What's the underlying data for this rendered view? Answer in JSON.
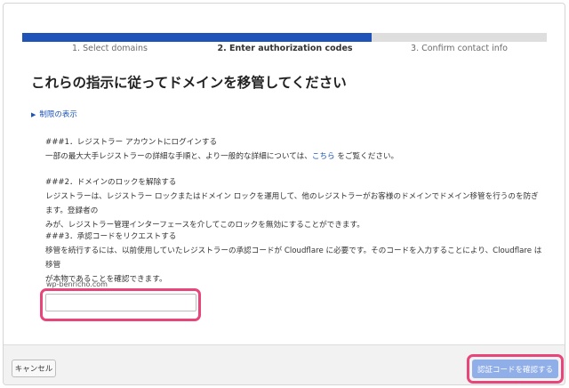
{
  "steps": [
    {
      "label": "1. Select domains",
      "status": "complete"
    },
    {
      "label": "2. Enter authorization codes",
      "status": "current"
    },
    {
      "label": "3. Confirm contact info",
      "status": "pending"
    }
  ],
  "page": {
    "title": "これらの指示に従ってドメインを移管してください",
    "toggle_label": "制限の表示"
  },
  "sections": [
    {
      "heading": "###1．レジストラー アカウントにログインする",
      "body_pre": "一部の最大大手レジストラーの詳細な手順と、より一般的な詳細については、",
      "link": "こちら",
      "body_post": " をご覧ください。"
    },
    {
      "heading": "###2．ドメインのロックを解除する",
      "body_line1": "レジストラーは、レジストラー ロックまたはドメイン ロックを運用して、他のレジストラーがお客様のドメインでドメイン移管を行うのを防ぎます。登録者の",
      "body_line2": "みが、レジストラー管理インターフェースを介してこのロックを無効にすることができます。"
    },
    {
      "heading": "###3．承認コードをリクエストする",
      "body_line1": "移管を続行するには、以前使用していたレジストラーの承認コードが Cloudflare に必要です。そのコードを入力することにより、Cloudflare は移管",
      "body_line2": "が本物であることを確認できます。"
    }
  ],
  "form": {
    "domain_label": "wp-benricho.com",
    "auth_code_value": ""
  },
  "footer": {
    "cancel_label": "キャンセル",
    "confirm_label": "認証コードを確認する"
  },
  "colors": {
    "accent": "#1e54b7",
    "progress_pending": "#dedede",
    "highlight": "#e8457a",
    "confirm_button": "#90aee8"
  }
}
